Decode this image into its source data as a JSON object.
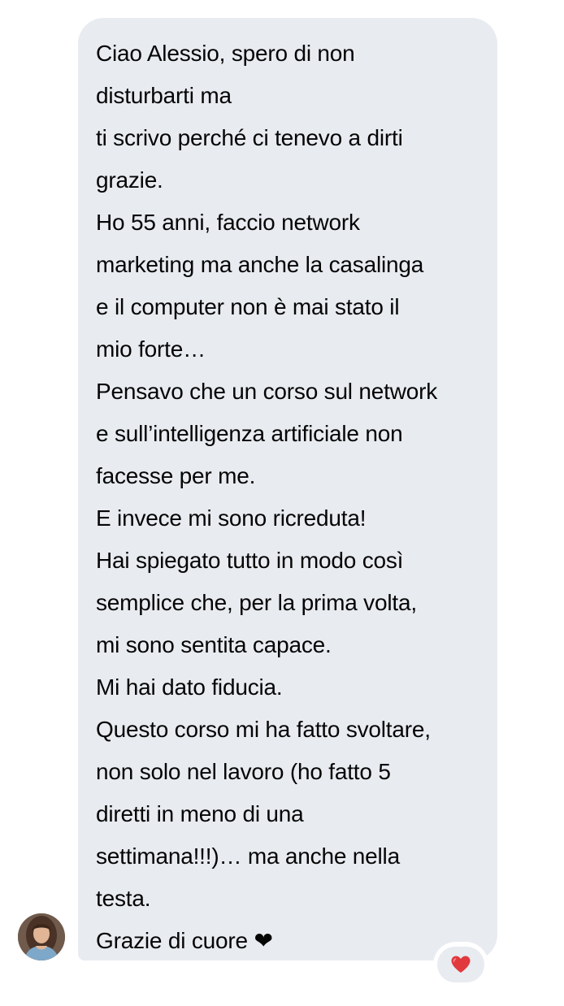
{
  "message": {
    "lines": [
      "Ciao Alessio, spero di non",
      "disturbarti ma",
      "ti scrivo perché ci tenevo a dirti",
      "grazie.",
      "Ho 55 anni, faccio network",
      "marketing ma anche la casalinga",
      "e il computer non è mai stato il",
      "mio forte…",
      "Pensavo che un corso sul network",
      "e sull’intelligenza artificiale non",
      "facesse per me.",
      "E invece mi sono ricreduta!",
      "Hai spiegato tutto in modo così",
      "semplice che, per la prima volta,",
      "mi sono sentita capace.",
      "Mi hai dato fiducia.",
      "Questo corso mi ha fatto svoltare,",
      "non solo nel lavoro (ho fatto 5",
      "diretti in meno di una",
      "settimana!!!)… ma anche nella",
      "testa.",
      "Grazie di cuore ❤"
    ]
  },
  "sender": {
    "avatar_icon": "user-photo-avatar"
  },
  "reaction": {
    "icon": "red-heart-icon",
    "color": "#e0393e"
  },
  "colors": {
    "bubble": "#e8ebf0",
    "text": "#050505"
  }
}
